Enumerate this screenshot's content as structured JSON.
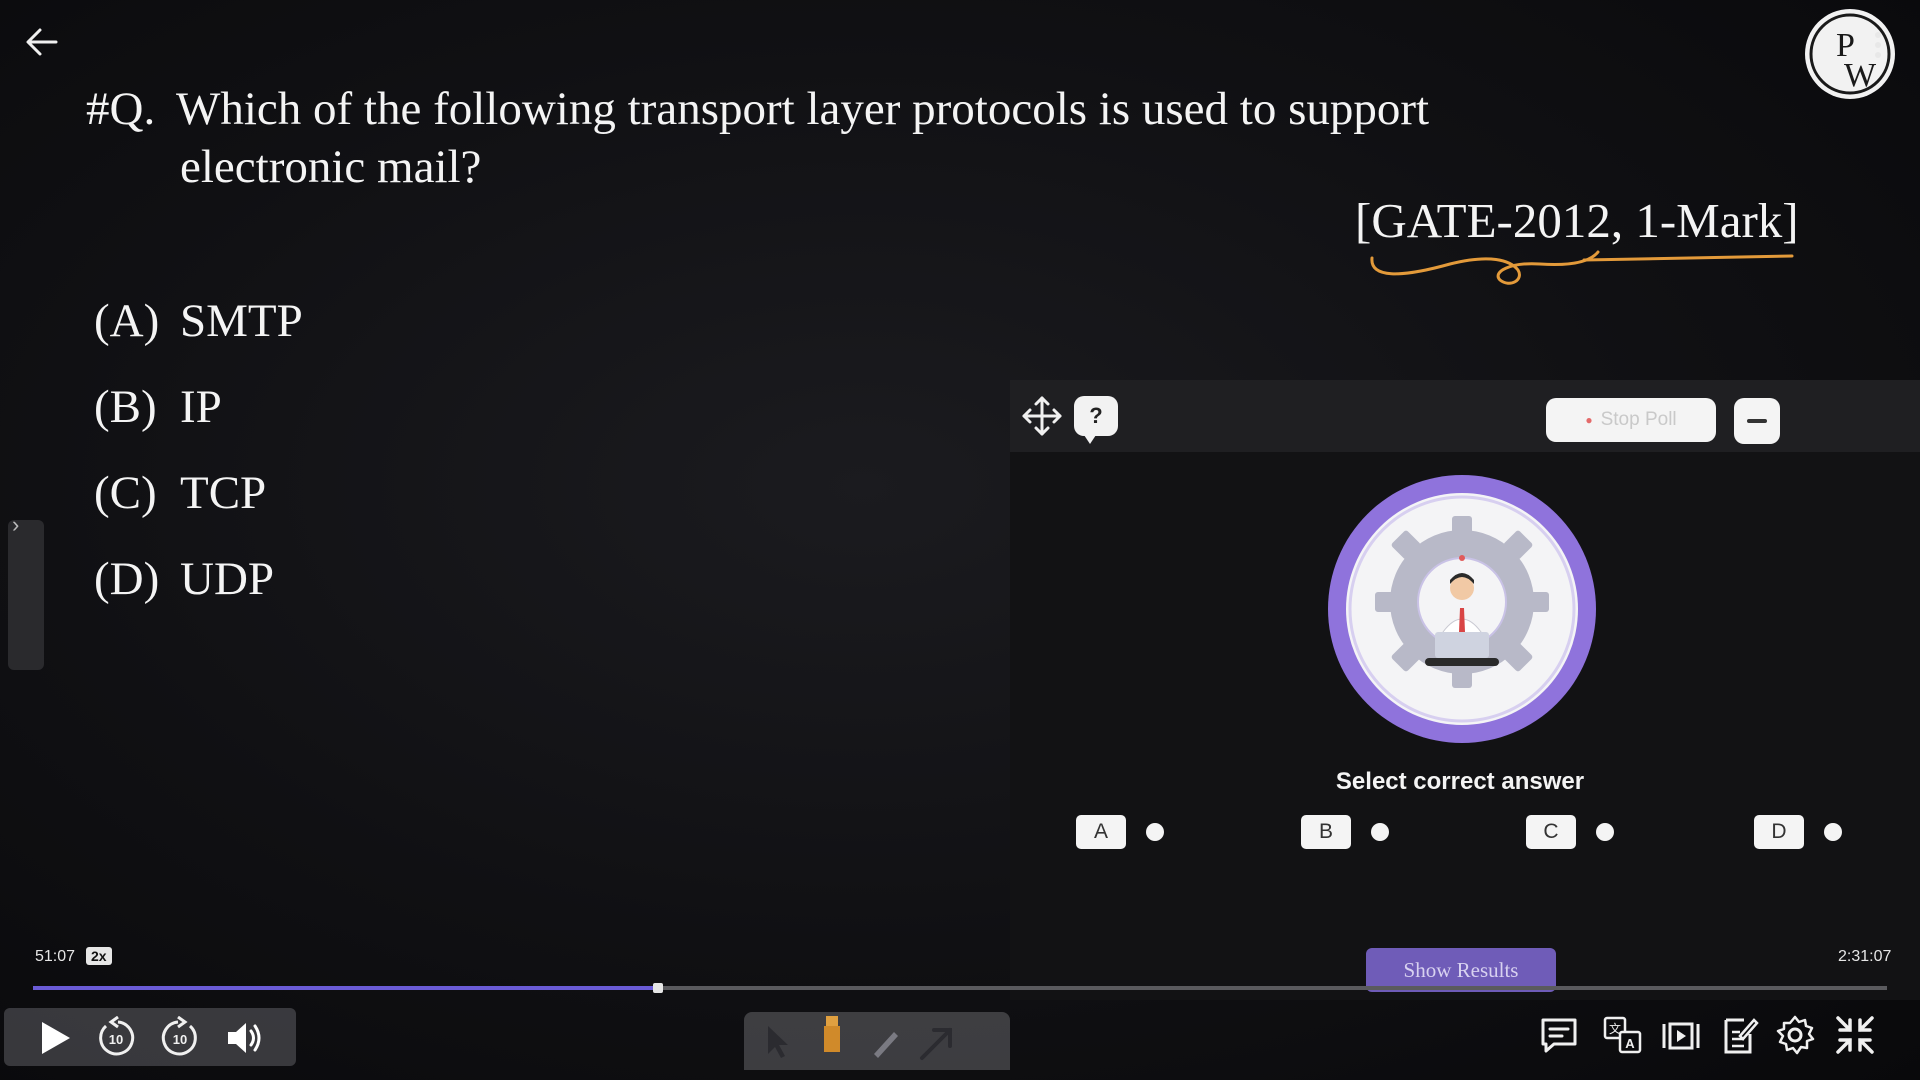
{
  "question": {
    "number": "#Q.",
    "text_line1": "Which of the following transport layer protocols is used to support",
    "text_line2": "electronic mail?",
    "source": "[GATE-2012, 1-Mark]"
  },
  "options": [
    {
      "letter": "(A)",
      "text": "SMTP"
    },
    {
      "letter": "(B)",
      "text": "IP"
    },
    {
      "letter": "(C)",
      "text": "TCP"
    },
    {
      "letter": "(D)",
      "text": "UDP"
    }
  ],
  "poll": {
    "help_label": "?",
    "stop_poll_label": "Stop Poll",
    "select_label": "Select correct answer",
    "choices": [
      "A",
      "B",
      "C",
      "D"
    ],
    "show_results_label": "Show Results"
  },
  "player": {
    "time_current": "51:07",
    "speed": "2x",
    "time_total": "2:31:07",
    "progress_fraction": 0.337,
    "rewind_label": "10",
    "forward_label": "10"
  },
  "logo_text": "PW",
  "colors": {
    "accent": "#6a5bd6",
    "poll_ring": "#9b7be0",
    "underline": "#e39a3a"
  },
  "icons": [
    "back-arrow-icon",
    "logo",
    "kebab-icon",
    "move-icon",
    "help-icon",
    "play-icon",
    "rewind-icon",
    "forward-icon",
    "volume-icon",
    "pointer-icon",
    "highlighter-icon",
    "pen-icon",
    "arrow-tool-icon",
    "chat-icon",
    "translate-icon",
    "playlist-icon",
    "notes-icon",
    "settings-icon",
    "exit-fullscreen-icon"
  ]
}
